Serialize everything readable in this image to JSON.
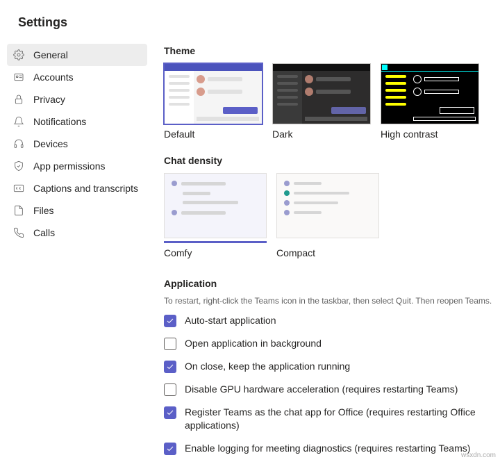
{
  "title": "Settings",
  "sidebar": {
    "items": [
      {
        "id": "general",
        "label": "General",
        "icon": "gear",
        "active": true
      },
      {
        "id": "accounts",
        "label": "Accounts",
        "icon": "card"
      },
      {
        "id": "privacy",
        "label": "Privacy",
        "icon": "lock"
      },
      {
        "id": "notifications",
        "label": "Notifications",
        "icon": "bell"
      },
      {
        "id": "devices",
        "label": "Devices",
        "icon": "headset"
      },
      {
        "id": "app-permissions",
        "label": "App permissions",
        "icon": "shield"
      },
      {
        "id": "captions",
        "label": "Captions and transcripts",
        "icon": "cc"
      },
      {
        "id": "files",
        "label": "Files",
        "icon": "file"
      },
      {
        "id": "calls",
        "label": "Calls",
        "icon": "phone"
      }
    ]
  },
  "theme": {
    "heading": "Theme",
    "options": [
      {
        "id": "default",
        "label": "Default",
        "selected": true
      },
      {
        "id": "dark",
        "label": "Dark"
      },
      {
        "id": "high-contrast",
        "label": "High contrast"
      }
    ]
  },
  "chat_density": {
    "heading": "Chat density",
    "options": [
      {
        "id": "comfy",
        "label": "Comfy",
        "selected": true
      },
      {
        "id": "compact",
        "label": "Compact"
      }
    ]
  },
  "application": {
    "heading": "Application",
    "tip": "To restart, right-click the Teams icon in the taskbar, then select Quit. Then reopen Teams.",
    "checkboxes": [
      {
        "checked": true,
        "label": "Auto-start application"
      },
      {
        "checked": false,
        "label": "Open application in background"
      },
      {
        "checked": true,
        "label": "On close, keep the application running"
      },
      {
        "checked": false,
        "label": "Disable GPU hardware acceleration (requires restarting Teams)"
      },
      {
        "checked": true,
        "label": "Register Teams as the chat app for Office (requires restarting Office applications)"
      },
      {
        "checked": true,
        "label": "Enable logging for meeting diagnostics (requires restarting Teams)"
      }
    ]
  },
  "watermark": "wsxdn.com"
}
